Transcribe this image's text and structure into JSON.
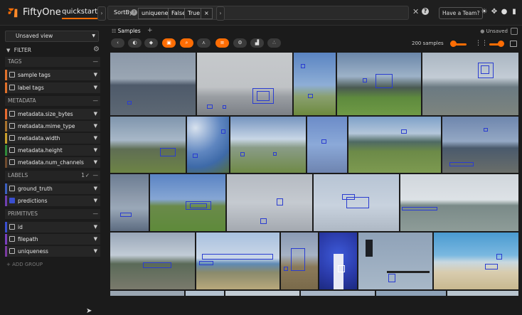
{
  "header": {
    "brand": "FiftyOne",
    "dataset": "quickstart",
    "view_bar": {
      "stage_name": "SortBy",
      "help": "?",
      "params": [
        "uniqueness",
        "False",
        "True"
      ],
      "remove": "×"
    },
    "clear": "✕",
    "help": "?",
    "team_button": "Have a Team?",
    "icons": [
      "sun-icon",
      "slack-icon",
      "github-icon",
      "docs-icon"
    ]
  },
  "sidebar": {
    "view_select": "Unsaved view",
    "filter_title": "FILTER",
    "groups": [
      {
        "title": "TAGS",
        "items": [
          {
            "label": "sample tags",
            "color": "#e0702a"
          },
          {
            "label": "label tags",
            "color": "#e0702a"
          }
        ]
      },
      {
        "title": "METADATA",
        "items": [
          {
            "label": "metadata.size_bytes",
            "color": "#e86a2f"
          },
          {
            "label": "metadata.mime_type",
            "color": "#a8732e"
          },
          {
            "label": "metadata.width",
            "color": "#c9a02b"
          },
          {
            "label": "metadata.height",
            "color": "#2f8a3a"
          },
          {
            "label": "metadata.num_channels",
            "color": "#6e4a2e"
          }
        ]
      },
      {
        "title": "LABELS",
        "count": "1",
        "items": [
          {
            "label": "ground_truth",
            "color": "#3b5fbf"
          },
          {
            "label": "predictions",
            "color": "#6f3fb0"
          }
        ]
      },
      {
        "title": "PRIMITIVES",
        "items": [
          {
            "label": "id",
            "color": "#3a4fd0"
          },
          {
            "label": "filepath",
            "color": "#7b3fbf"
          },
          {
            "label": "uniqueness",
            "color": "#7a3aa0"
          }
        ]
      }
    ],
    "add_group": "+ ADD GROUP"
  },
  "samples_panel": {
    "tab": "Samples",
    "add_tab": "+",
    "unsaved": "Unsaved",
    "count_label": "200 samples"
  },
  "colors": {
    "accent": "#ff6d04",
    "background": "#1b1b1b",
    "panel": "#262626"
  }
}
